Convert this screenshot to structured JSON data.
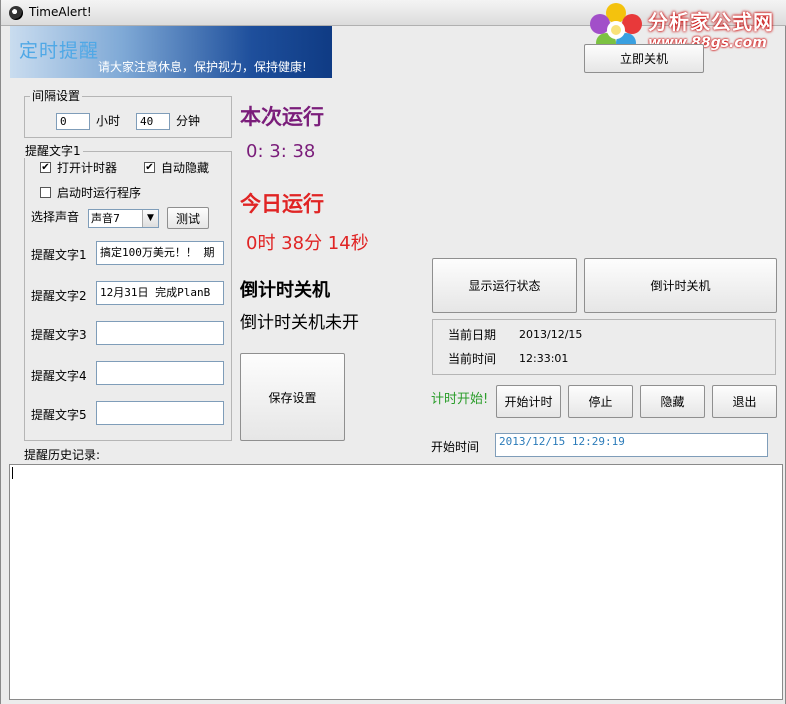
{
  "window": {
    "title": "TimeAlert!"
  },
  "logo": {
    "name": "分析家公式网",
    "url": "www.88gs.com"
  },
  "banner": {
    "title": "定时提醒",
    "subtitle": "请大家注意休息，保护视力，保持健康!"
  },
  "top_button": {
    "label": "立即关机"
  },
  "interval": {
    "legend": "间隔设置",
    "hours_value": "0",
    "hours_label": "小时",
    "minutes_value": "40",
    "minutes_label": "分钟"
  },
  "reminder": {
    "legend": "提醒文字1",
    "open_timer": {
      "label": "打开计时器",
      "checked": true
    },
    "auto_hide": {
      "label": "自动隐藏",
      "checked": true
    },
    "run_on_start": {
      "label": "启动时运行程序",
      "checked": false
    },
    "sound_label": "选择声音",
    "sound_value": "声音7",
    "test_button": "测试",
    "texts": [
      {
        "label": "提醒文字1",
        "value": "搞定100万美元！！ 期"
      },
      {
        "label": "提醒文字2",
        "value": "12月31日 完成PlanB"
      },
      {
        "label": "提醒文字3",
        "value": ""
      },
      {
        "label": "提醒文字4",
        "value": ""
      },
      {
        "label": "提醒文字5",
        "value": ""
      }
    ]
  },
  "save_button": "保存设置",
  "history_label": "提醒历史记录:",
  "run": {
    "this_run_title": "本次运行",
    "this_run_value": "0: 3: 38",
    "today_title": "今日运行",
    "today_value": "0时 38分 14秒",
    "shutdown_title": "倒计时关机",
    "shutdown_status": "倒计时关机未开"
  },
  "buttons": {
    "show_status": "显示运行状态",
    "countdown_shutdown": "倒计时关机",
    "start_timer": "开始计时",
    "stop": "停止",
    "hide": "隐藏",
    "exit": "退出"
  },
  "current": {
    "date_label": "当前日期",
    "date_value": "2013/12/15",
    "time_label": "当前时间",
    "time_value": "12:33:01"
  },
  "timer_start_label": "计时开始!",
  "start_time": {
    "label": "开始时间",
    "value": "2013/12/15    12:29:19"
  },
  "colors": {
    "accent_green": "#2a9d2a",
    "purple": "#7a1d7a",
    "red": "#e02424"
  }
}
